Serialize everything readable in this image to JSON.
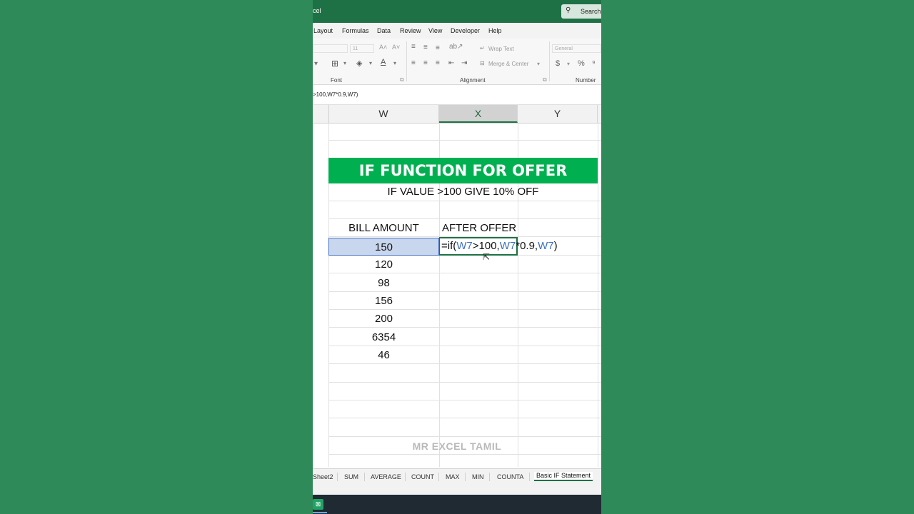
{
  "window": {
    "title": "cel",
    "search_label": "Search"
  },
  "menu": [
    "Layout",
    "Formulas",
    "Data",
    "Review",
    "View",
    "Developer",
    "Help"
  ],
  "ribbon": {
    "font_size": "11",
    "font_group_label": "Font",
    "alignment_group_label": "Alignment",
    "number_group_label": "Number",
    "wrap_text_label": "Wrap Text",
    "merge_center_label": "Merge & Center",
    "number_format": "General"
  },
  "formula_bar": {
    "text": ">100,W7*0.9,W7)"
  },
  "columns": [
    "W",
    "X",
    "Y"
  ],
  "selected_column": "X",
  "sheet": {
    "banner": "IF FUNCTION FOR OFFER",
    "subtitle": "IF VALUE >100 GIVE 10% OFF",
    "header_bill": "BILL AMOUNT",
    "header_after": "AFTER OFFER",
    "bill_amounts": [
      "150",
      "120",
      "98",
      "156",
      "200",
      "6354",
      "46"
    ],
    "edit_formula": {
      "p1": "=if(",
      "r1": "W7",
      "p2": ">100,",
      "r2": "W7",
      "p3": "*0.9,",
      "r3": "W7",
      "p4": ")"
    }
  },
  "watermark": "MR EXCEL TAMIL",
  "tabs": [
    "Sheet2",
    "SUM",
    "AVERAGE",
    "COUNT",
    "MAX",
    "MIN",
    "COUNTA",
    "Basic IF Statement"
  ],
  "active_tab": "Basic IF Statement",
  "colors": {
    "accent": "#1e7145",
    "banner": "#00b050",
    "reference": "#3e72c1",
    "selection": "#c9d7ee"
  }
}
